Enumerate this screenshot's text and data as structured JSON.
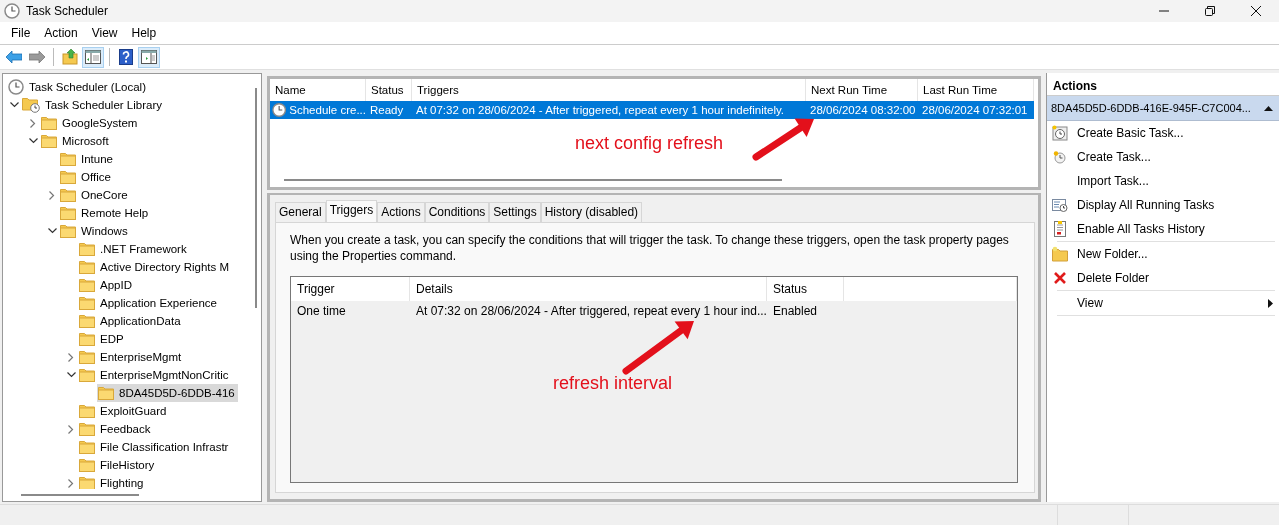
{
  "window": {
    "title": "Task Scheduler"
  },
  "menu": [
    "File",
    "Action",
    "View",
    "Help"
  ],
  "toolbar": [
    {
      "kind": "back",
      "pressed": false
    },
    {
      "kind": "forward",
      "pressed": false
    },
    {
      "kind": "up",
      "pressed": false
    },
    {
      "kind": "console-tree",
      "pressed": true
    },
    {
      "kind": "help",
      "pressed": false
    },
    {
      "kind": "action-pane",
      "pressed": true
    }
  ],
  "tree": [
    {
      "label": "Task Scheduler (Local)",
      "kind": "clock",
      "selected": false,
      "children": [
        {
          "label": "Task Scheduler Library",
          "kind": "library",
          "expanded": true,
          "selected": false,
          "children": [
            {
              "label": "GoogleSystem",
              "kind": "folder",
              "expanded": false,
              "selected": false
            },
            {
              "label": "Microsoft",
              "kind": "folder",
              "expanded": true,
              "selected": false,
              "children": [
                {
                  "label": "Intune",
                  "kind": "folder",
                  "selected": false
                },
                {
                  "label": "Office",
                  "kind": "folder",
                  "selected": false
                },
                {
                  "label": "OneCore",
                  "kind": "folder",
                  "expanded": false,
                  "selected": false
                },
                {
                  "label": "Remote Help",
                  "kind": "folder",
                  "selected": false
                },
                {
                  "label": "Windows",
                  "kind": "folder",
                  "expanded": true,
                  "selected": false,
                  "children": [
                    {
                      "label": ".NET Framework",
                      "kind": "folder",
                      "selected": false
                    },
                    {
                      "label": "Active Directory Rights M",
                      "kind": "folder",
                      "selected": false
                    },
                    {
                      "label": "AppID",
                      "kind": "folder",
                      "selected": false
                    },
                    {
                      "label": "Application Experience",
                      "kind": "folder",
                      "selected": false
                    },
                    {
                      "label": "ApplicationData",
                      "kind": "folder",
                      "selected": false
                    },
                    {
                      "label": "EDP",
                      "kind": "folder",
                      "selected": false
                    },
                    {
                      "label": "EnterpriseMgmt",
                      "kind": "folder",
                      "expanded": false,
                      "selected": false
                    },
                    {
                      "label": "EnterpriseMgmtNonCritic",
                      "kind": "folder",
                      "expanded": true,
                      "selected": false,
                      "children": [
                        {
                          "label": "8DA45D5D-6DDB-416",
                          "kind": "folder",
                          "selected": true
                        }
                      ]
                    },
                    {
                      "label": "ExploitGuard",
                      "kind": "folder",
                      "selected": false
                    },
                    {
                      "label": "Feedback",
                      "kind": "folder",
                      "expanded": false,
                      "selected": false
                    },
                    {
                      "label": "File Classification Infrastr",
                      "kind": "folder",
                      "selected": false
                    },
                    {
                      "label": "FileHistory",
                      "kind": "folder",
                      "selected": false
                    },
                    {
                      "label": "Flighting",
                      "kind": "folder",
                      "expanded": false,
                      "selected": false
                    }
                  ]
                }
              ]
            }
          ]
        }
      ]
    }
  ],
  "tasks": {
    "columns": [
      "Name",
      "Status",
      "Triggers",
      "Next Run Time",
      "Last Run Time"
    ],
    "rows": [
      {
        "selected": true,
        "cells": [
          "Schedule cre...",
          "Ready",
          "At 07:32 on 28/06/2024 - After triggered, repeat every 1 hour indefinitely.",
          "28/06/2024 08:32:00",
          "28/06/2024 07:32:01"
        ]
      }
    ],
    "annotation": "next config refresh"
  },
  "tabs": [
    {
      "label": "General",
      "selected": false
    },
    {
      "label": "Triggers",
      "selected": true
    },
    {
      "label": "Actions",
      "selected": false
    },
    {
      "label": "Conditions",
      "selected": false
    },
    {
      "label": "Settings",
      "selected": false
    },
    {
      "label": "History (disabled)",
      "selected": false
    }
  ],
  "triggers": {
    "description": "When you create a task, you can specify the conditions that will trigger the task.  To change these triggers, open the task property pages using the Properties command.",
    "columns": [
      "Trigger",
      "Details",
      "Status"
    ],
    "rows": [
      {
        "cells": [
          "One time",
          "At 07:32 on 28/06/2024 - After triggered, repeat every 1 hour ind...",
          "Enabled"
        ]
      }
    ],
    "annotation": "refresh interval"
  },
  "actions": {
    "title": "Actions",
    "section": {
      "title": "8DA45D5D-6DDB-416E-945F-C7C004...",
      "expanded": true
    },
    "items": [
      {
        "kind": "basic-task",
        "label": "Create Basic Task..."
      },
      {
        "kind": "task",
        "label": "Create Task..."
      },
      {
        "kind": "plain",
        "label": "Import Task..."
      },
      {
        "kind": "running",
        "label": "Display All Running Tasks"
      },
      {
        "kind": "history",
        "label": "Enable All Tasks History"
      },
      {
        "kind": "separator"
      },
      {
        "kind": "new-folder",
        "label": "New Folder..."
      },
      {
        "kind": "delete",
        "label": "Delete Folder"
      },
      {
        "kind": "separator"
      },
      {
        "kind": "plain",
        "label": "View",
        "submenu": true
      },
      {
        "kind": "separator"
      }
    ]
  }
}
